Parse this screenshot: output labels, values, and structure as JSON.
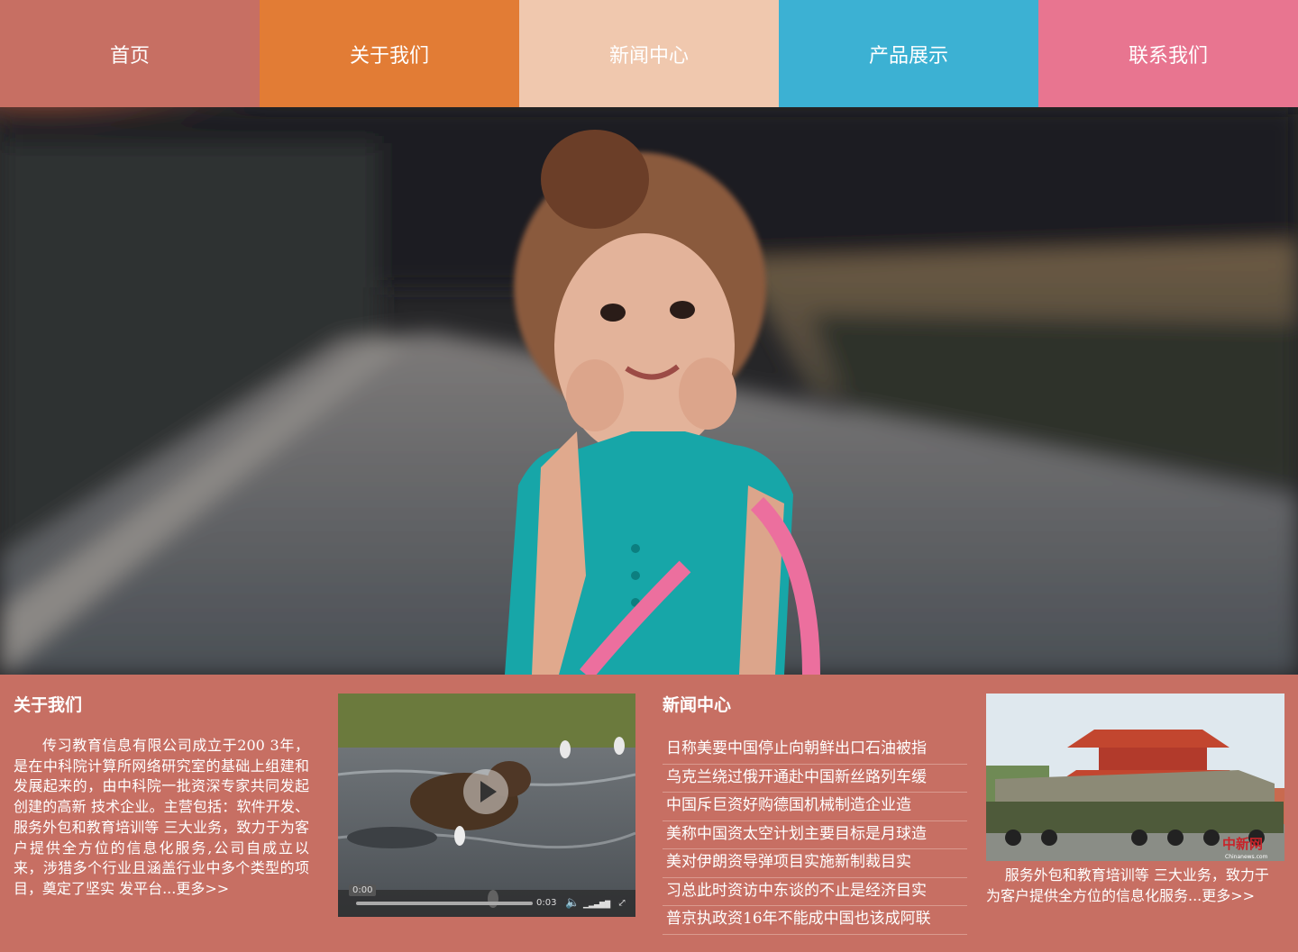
{
  "nav": {
    "items": [
      {
        "label": "首页",
        "color": "#c76f63"
      },
      {
        "label": "关于我们",
        "color": "#e27c35"
      },
      {
        "label": "新闻中心",
        "color": "#f0c8ae"
      },
      {
        "label": "产品展示",
        "color": "#3cb1d3"
      },
      {
        "label": "联系我们",
        "color": "#e87590"
      }
    ]
  },
  "about": {
    "title": "关于我们",
    "text": "传习教育信息有限公司成立于200 3年，是在中科院计算所网络研究室的基础上组建和 发展起来的，由中科院一批资深专家共同发起创建的高新 技术企业。主营包括：软件开发、服务外包和教育培训等 三大业务，致力于为客户提供全方位的信息化服务,公司自成立以 来，涉猎多个行业且涵盖行业中多个类型的项目，奠定了坚实 发平台...",
    "more": "更多>>"
  },
  "video": {
    "current_time": "0:00",
    "duration": "0:03",
    "play_icon": "play-icon"
  },
  "news": {
    "title": "新闻中心",
    "items": [
      "日称美要中国停止向朝鲜出口石油被指",
      "乌克兰绕过俄开通赴中国新丝路列车缓",
      "中国斥巨资好购德国机械制造企业造",
      "美称中国资太空计划主要目标是月球造",
      "美对伊朗资导弹项目实施新制裁目实",
      "习总此时资访中东谈的不止是经济目实",
      "普京执政资16年不能成中国也该成阿联"
    ]
  },
  "photo": {
    "watermark": "中新网",
    "watermark_sub": "Chinanews.com",
    "text": "服务外包和教育培训等 三大业务，致力于为客户提供全方位的信息化服务...",
    "more": "更多>>"
  }
}
